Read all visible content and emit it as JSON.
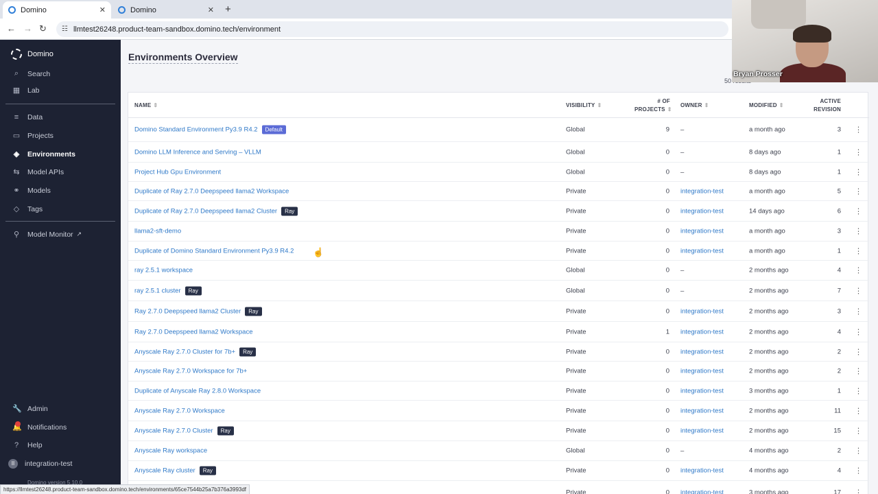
{
  "browser": {
    "tabs": [
      {
        "title": "Domino",
        "active": true
      },
      {
        "title": "Domino",
        "active": false
      }
    ],
    "new_tab": "+",
    "url": "llmtest26248.product-team-sandbox.domino.tech/environment",
    "status_url": "https://llmtest26248.product-team-sandbox.domino.tech/environments/65ce7544b25a7b376a3993df"
  },
  "sidebar": {
    "brand": "Domino",
    "top_items": [
      {
        "label": "Search",
        "icon": "search-icon"
      },
      {
        "label": "Lab",
        "icon": "grid-icon"
      }
    ],
    "mid_items": [
      {
        "label": "Data",
        "icon": "database-icon"
      },
      {
        "label": "Projects",
        "icon": "folder-icon"
      },
      {
        "label": "Environments",
        "icon": "cube-icon",
        "active": true
      },
      {
        "label": "Model APIs",
        "icon": "arrows-icon"
      },
      {
        "label": "Models",
        "icon": "network-icon"
      },
      {
        "label": "Tags",
        "icon": "tag-icon"
      }
    ],
    "monitor_item": {
      "label": "Model Monitor",
      "icon": "monitor-icon"
    },
    "bottom_items": [
      {
        "label": "Admin",
        "icon": "wrench-icon"
      },
      {
        "label": "Notifications",
        "icon": "bell-icon"
      },
      {
        "label": "Help",
        "icon": "help-icon"
      },
      {
        "label": "integration-test",
        "icon": "avatar-icon"
      }
    ],
    "version": "Domino version 5.10.0"
  },
  "main": {
    "title": "Environments Overview",
    "count_text": "50 results"
  },
  "table": {
    "columns": {
      "name": "NAME",
      "visibility": "VISIBILITY",
      "projects_1": "# OF",
      "projects_2": "PROJECTS",
      "owner": "OWNER",
      "modified": "MODIFIED",
      "revision_1": "ACTIVE",
      "revision_2": "REVISION"
    },
    "rows": [
      {
        "name": "Domino Standard Environment Py3.9 R4.2",
        "badge": "Default",
        "visibility": "Global",
        "projects": "9",
        "owner": "–",
        "modified": "a month ago",
        "revision": "3"
      },
      {
        "name": "Domino LLM Inference and Serving – VLLM",
        "badge": "",
        "visibility": "Global",
        "projects": "0",
        "owner": "–",
        "modified": "8 days ago",
        "revision": "1"
      },
      {
        "name": "Project Hub Gpu Environment",
        "badge": "",
        "visibility": "Global",
        "projects": "0",
        "owner": "–",
        "modified": "8 days ago",
        "revision": "1"
      },
      {
        "name": "Duplicate of Ray 2.7.0 Deepspeed llama2 Workspace",
        "badge": "",
        "visibility": "Private",
        "projects": "0",
        "owner": "integration-test",
        "modified": "a month ago",
        "revision": "5"
      },
      {
        "name": "Duplicate of Ray 2.7.0 Deepspeed llama2 Cluster",
        "badge": "Ray",
        "visibility": "Private",
        "projects": "0",
        "owner": "integration-test",
        "modified": "14 days ago",
        "revision": "6"
      },
      {
        "name": "llama2-sft-demo",
        "badge": "",
        "visibility": "Private",
        "projects": "0",
        "owner": "integration-test",
        "modified": "a month ago",
        "revision": "3"
      },
      {
        "name": "Duplicate of Domino Standard Environment Py3.9 R4.2",
        "badge": "",
        "visibility": "Private",
        "projects": "0",
        "owner": "integration-test",
        "modified": "a month ago",
        "revision": "1"
      },
      {
        "name": "ray 2.5.1 workspace",
        "badge": "",
        "visibility": "Global",
        "projects": "0",
        "owner": "–",
        "modified": "2 months ago",
        "revision": "4"
      },
      {
        "name": "ray 2.5.1 cluster",
        "badge": "Ray",
        "visibility": "Global",
        "projects": "0",
        "owner": "–",
        "modified": "2 months ago",
        "revision": "7"
      },
      {
        "name": "Ray 2.7.0 Deepspeed llama2 Cluster",
        "badge": "Ray",
        "visibility": "Private",
        "projects": "0",
        "owner": "integration-test",
        "modified": "2 months ago",
        "revision": "3"
      },
      {
        "name": "Ray 2.7.0 Deepspeed llama2 Workspace",
        "badge": "",
        "visibility": "Private",
        "projects": "1",
        "owner": "integration-test",
        "modified": "2 months ago",
        "revision": "4"
      },
      {
        "name": "Anyscale Ray 2.7.0 Cluster for 7b+",
        "badge": "Ray",
        "visibility": "Private",
        "projects": "0",
        "owner": "integration-test",
        "modified": "2 months ago",
        "revision": "2"
      },
      {
        "name": "Anyscale Ray 2.7.0 Workspace for 7b+",
        "badge": "",
        "visibility": "Private",
        "projects": "0",
        "owner": "integration-test",
        "modified": "2 months ago",
        "revision": "2"
      },
      {
        "name": "Duplicate of Anyscale Ray 2.8.0 Workspace",
        "badge": "",
        "visibility": "Private",
        "projects": "0",
        "owner": "integration-test",
        "modified": "3 months ago",
        "revision": "1"
      },
      {
        "name": "Anyscale Ray 2.7.0 Workspace",
        "badge": "",
        "visibility": "Private",
        "projects": "0",
        "owner": "integration-test",
        "modified": "2 months ago",
        "revision": "11"
      },
      {
        "name": "Anyscale Ray 2.7.0 Cluster",
        "badge": "Ray",
        "visibility": "Private",
        "projects": "0",
        "owner": "integration-test",
        "modified": "2 months ago",
        "revision": "15"
      },
      {
        "name": "Anyscale Ray workspace",
        "badge": "",
        "visibility": "Global",
        "projects": "0",
        "owner": "–",
        "modified": "4 months ago",
        "revision": "2"
      },
      {
        "name": "Anyscale Ray cluster",
        "badge": "Ray",
        "visibility": "Private",
        "projects": "0",
        "owner": "integration-test",
        "modified": "4 months ago",
        "revision": "4"
      },
      {
        "name": "",
        "badge": "",
        "visibility": "Private",
        "projects": "0",
        "owner": "integration-test",
        "modified": "3 months ago",
        "revision": "17"
      }
    ]
  },
  "webcam": {
    "name": "Bryan Prosser"
  }
}
